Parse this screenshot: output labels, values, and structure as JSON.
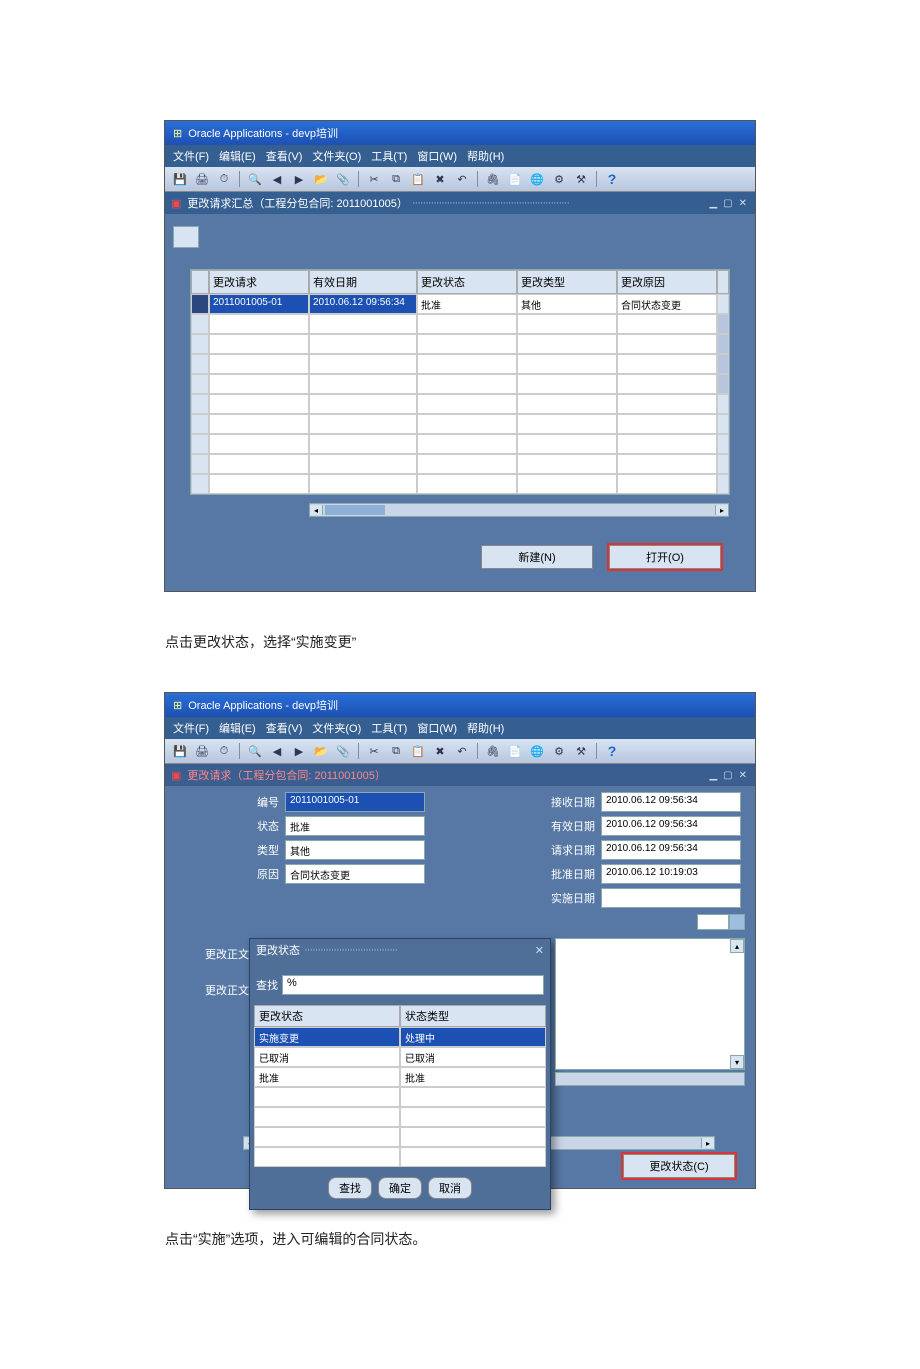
{
  "app_title": "Oracle Applications - devp培训",
  "menus": {
    "file": "文件(F)",
    "edit": "编辑(E)",
    "view": "查看(V)",
    "folder": "文件夹(O)",
    "tools": "工具(T)",
    "window": "窗口(W)",
    "help": "帮助(H)"
  },
  "shot1": {
    "inner_title": "更改请求汇总（工程分包合同: 2011001005）",
    "columns": {
      "c1": "更改请求",
      "c2": "有效日期",
      "c3": "更改状态",
      "c4": "更改类型",
      "c5": "更改原因"
    },
    "row1": {
      "req": "2011001005-01",
      "date": "2010.06.12 09:56:34",
      "status": "批准",
      "type": "其他",
      "reason": "合同状态变更"
    },
    "buttons": {
      "new": "新建(N)",
      "open": "打开(O)"
    }
  },
  "caption1": "点击更改状态，选择“实施变更”",
  "shot2": {
    "inner_title": "更改请求（工程分包合同: 2011001005）",
    "fields": {
      "no_lbl": "编号",
      "no_val": "2011001005-01",
      "status_lbl": "状态",
      "status_val": "批准",
      "type_lbl": "类型",
      "type_val": "其他",
      "reason_lbl": "原因",
      "reason_val": "合同状态变更",
      "recv_lbl": "接收日期",
      "recv_val": "2010.06.12 09:56:34",
      "eff_lbl": "有效日期",
      "eff_val": "2010.06.12 09:56:34",
      "req_lbl": "请求日期",
      "req_val": "2010.06.12 09:56:34",
      "appr_lbl": "批准日期",
      "appr_val": "2010.06.12 10:19:03",
      "impl_lbl": "实施日期",
      "impl_val": ""
    },
    "popup": {
      "title": "更改状态",
      "search_lbl": "查找",
      "search_val": "%",
      "cols": {
        "c1": "更改状态",
        "c2": "状态类型"
      },
      "items": {
        "r1c1": "实施变更",
        "r1c2": "处理中",
        "r2c1": "已取消",
        "r2c2": "已取消",
        "r3c1": "批准",
        "r3c2": "批准"
      },
      "buttons": {
        "find": "查找",
        "ok": "确定",
        "cancel": "取消"
      }
    },
    "body_labels": {
      "a": "更改正文",
      "b": "更改正文"
    },
    "change_status_btn": "更改状态(C)"
  },
  "caption2": "点击“实施”选项，进入可编辑的合同状态。"
}
